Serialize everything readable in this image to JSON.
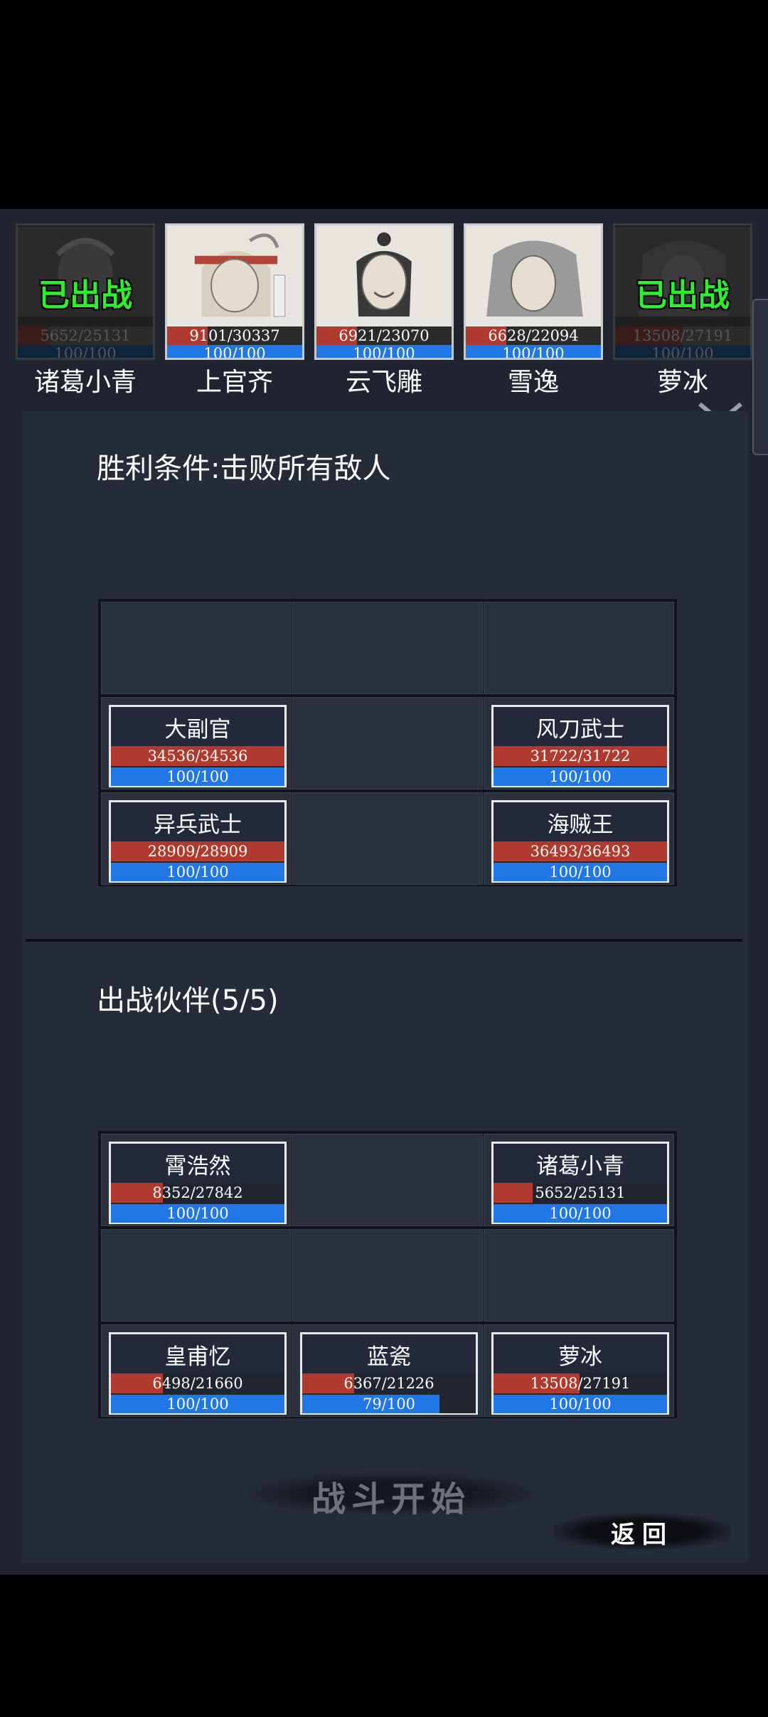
{
  "roster": [
    {
      "name": "诸葛小青",
      "status": "已出战",
      "hp": "5652/25131",
      "hp_ratio": 0.225,
      "mp": "100/100",
      "mp_ratio": 1.0,
      "deployed": true
    },
    {
      "name": "上官齐",
      "status": "",
      "hp": "9101/30337",
      "hp_ratio": 0.3,
      "mp": "100/100",
      "mp_ratio": 1.0,
      "deployed": false
    },
    {
      "name": "云飞雕",
      "status": "",
      "hp": "6921/23070",
      "hp_ratio": 0.3,
      "mp": "100/100",
      "mp_ratio": 1.0,
      "deployed": false
    },
    {
      "name": "雪逸",
      "status": "",
      "hp": "6628/22094",
      "hp_ratio": 0.3,
      "mp": "100/100",
      "mp_ratio": 1.0,
      "deployed": false
    },
    {
      "name": "萝冰",
      "status": "已出战",
      "hp": "13508/27191",
      "hp_ratio": 0.497,
      "mp": "100/100",
      "mp_ratio": 1.0,
      "deployed": true
    }
  ],
  "victory": {
    "label": "胜利条件:击败所有敌人"
  },
  "enemies": [
    {
      "name": "大副官",
      "hp": "34536/34536",
      "hp_ratio": 1.0,
      "mp": "100/100",
      "mp_ratio": 1.0
    },
    {
      "name": "风刀武士",
      "hp": "31722/31722",
      "hp_ratio": 1.0,
      "mp": "100/100",
      "mp_ratio": 1.0
    },
    {
      "name": "异兵武士",
      "hp": "28909/28909",
      "hp_ratio": 1.0,
      "mp": "100/100",
      "mp_ratio": 1.0
    },
    {
      "name": "海贼王",
      "hp": "36493/36493",
      "hp_ratio": 1.0,
      "mp": "100/100",
      "mp_ratio": 1.0
    }
  ],
  "partners_title": "出战伙伴(5/5)",
  "partners": [
    {
      "name": "霄浩然",
      "hp": "8352/27842",
      "hp_ratio": 0.3,
      "mp": "100/100",
      "mp_ratio": 1.0
    },
    {
      "name": "诸葛小青",
      "hp": "5652/25131",
      "hp_ratio": 0.225,
      "mp": "100/100",
      "mp_ratio": 1.0
    },
    {
      "name": "皇甫忆",
      "hp": "6498/21660",
      "hp_ratio": 0.3,
      "mp": "100/100",
      "mp_ratio": 1.0
    },
    {
      "name": "蓝瓷",
      "hp": "6367/21226",
      "hp_ratio": 0.3,
      "mp": "79/100",
      "mp_ratio": 0.79
    },
    {
      "name": "萝冰",
      "hp": "13508/27191",
      "hp_ratio": 0.497,
      "mp": "100/100",
      "mp_ratio": 1.0
    }
  ],
  "buttons": {
    "start": "战斗开始",
    "back": "返回"
  },
  "colors": {
    "hp": "#b03a2e",
    "mp": "#1f77e8",
    "deployed": "#2df02d"
  }
}
